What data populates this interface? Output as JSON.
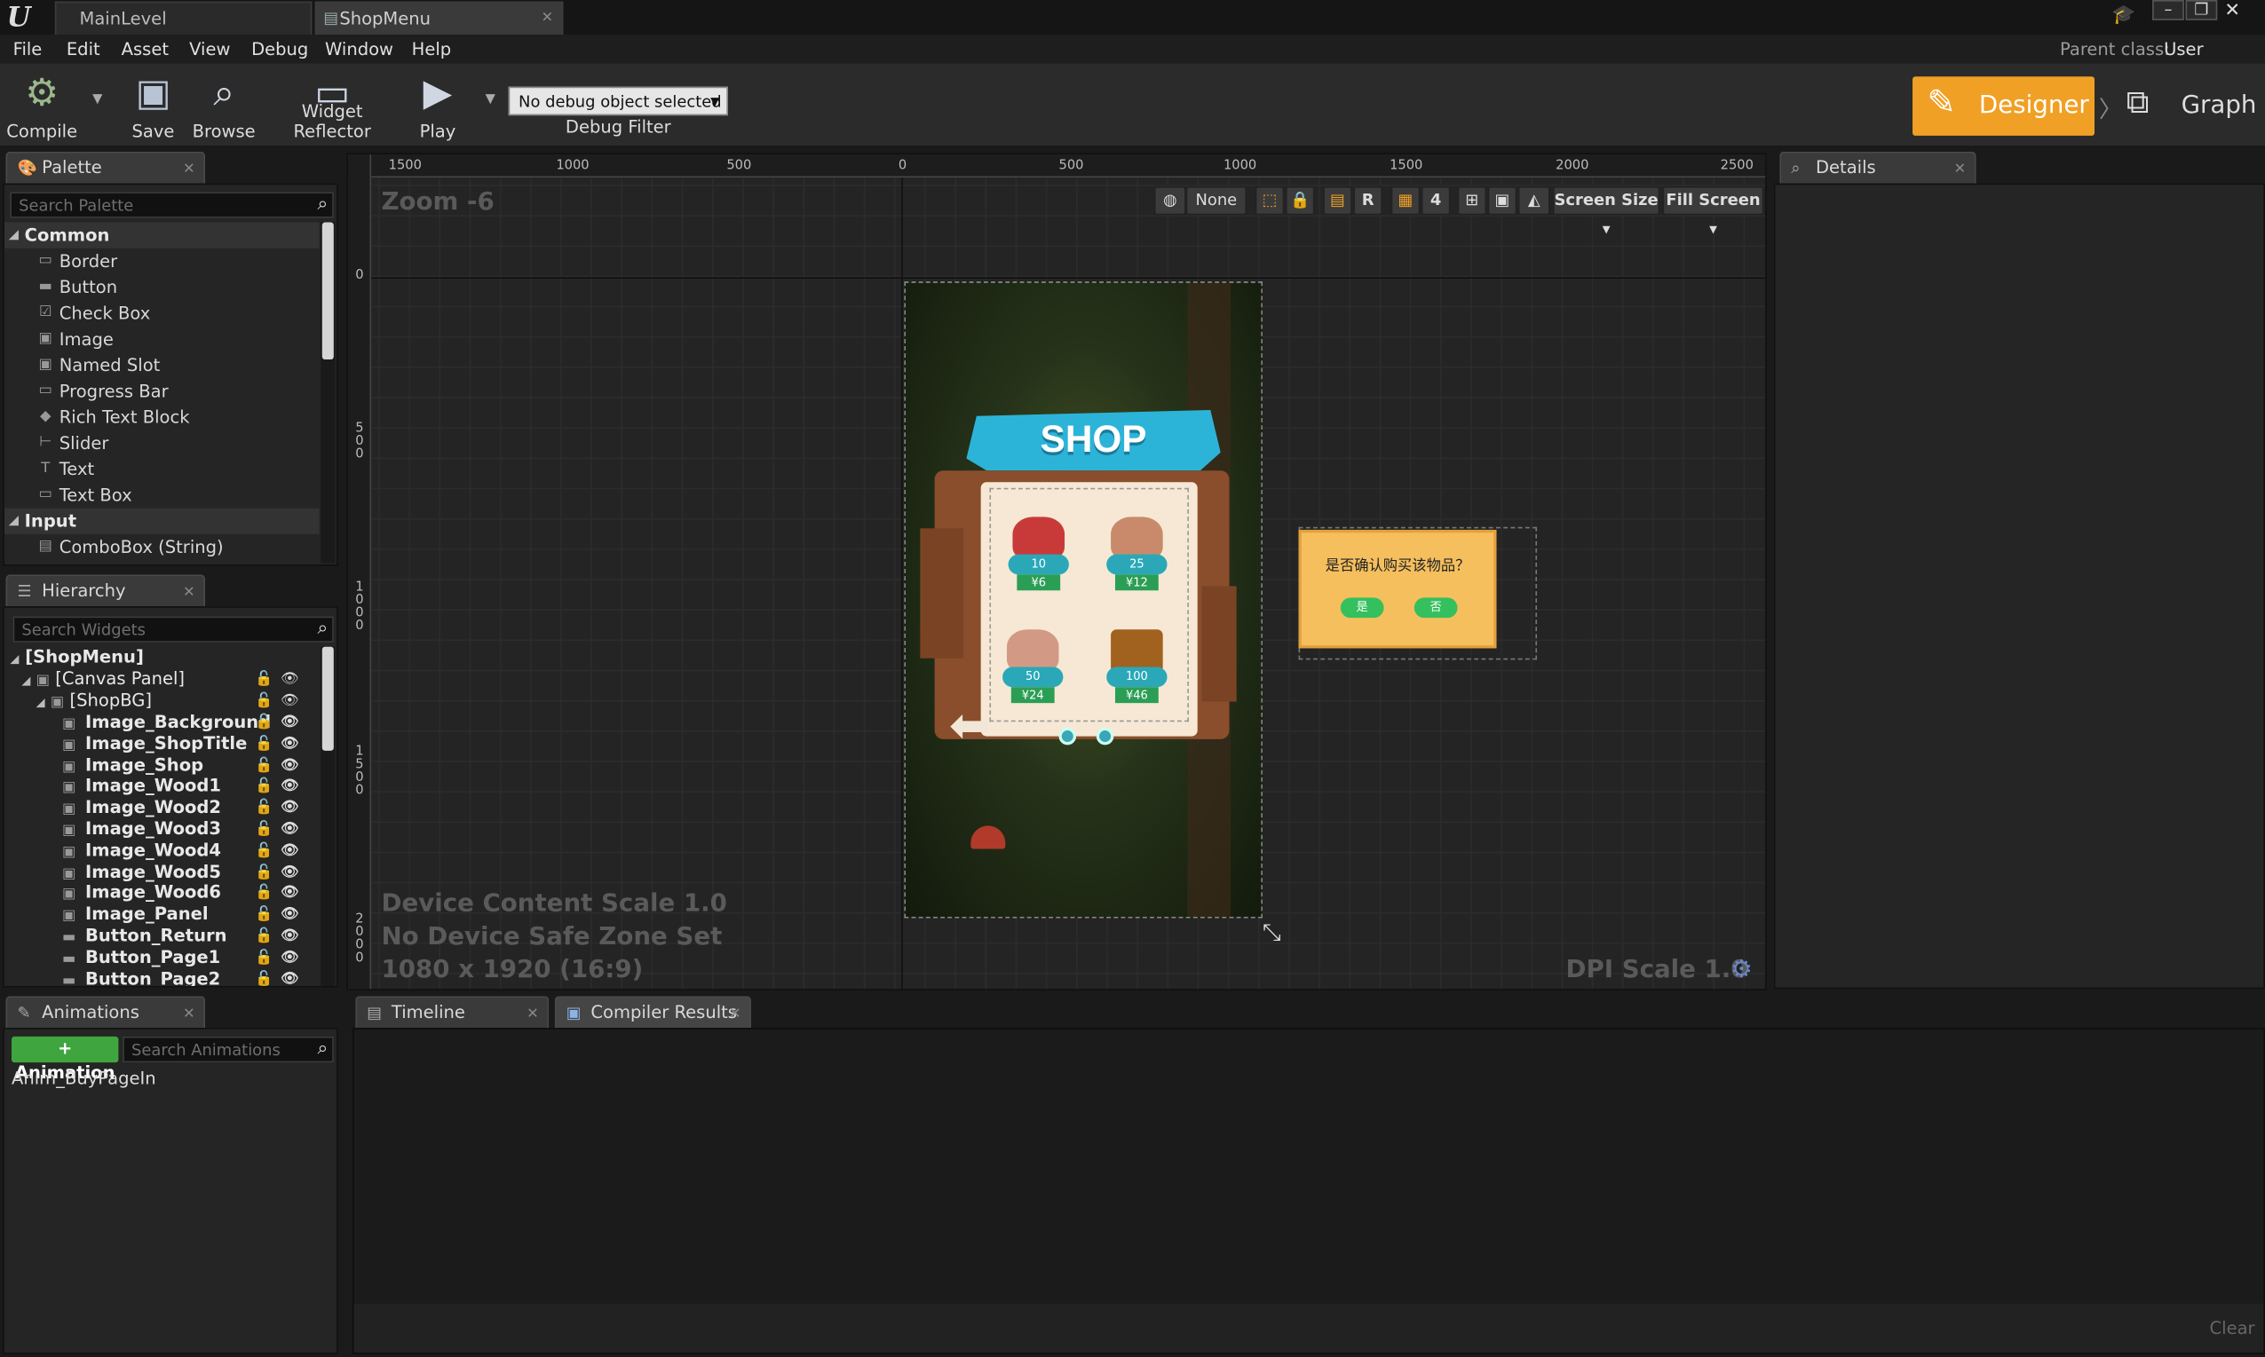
{
  "window": {
    "logo": "U",
    "tabs": [
      {
        "label": "MainLevel"
      },
      {
        "label": "ShopMenu"
      }
    ],
    "minimize": "–",
    "maximize": "❐",
    "close": "✕"
  },
  "menu": [
    "File",
    "Edit",
    "Asset",
    "View",
    "Debug",
    "Window",
    "Help"
  ],
  "parent_class": {
    "label": "Parent class:",
    "value": "User Widget"
  },
  "toolbar": {
    "compile": "Compile",
    "save": "Save",
    "browse": "Browse",
    "widget_reflector": "Widget Reflector",
    "play": "Play",
    "debug_object": "No debug object selected",
    "debug_filter": "Debug Filter"
  },
  "modes": {
    "designer": "Designer",
    "graph": "Graph"
  },
  "palette": {
    "title": "Palette",
    "search_placeholder": "Search Palette",
    "categories": [
      {
        "name": "Common",
        "items": [
          "Border",
          "Button",
          "Check Box",
          "Image",
          "Named Slot",
          "Progress Bar",
          "Rich Text Block",
          "Slider",
          "Text",
          "Text Box"
        ]
      },
      {
        "name": "Input",
        "items": [
          "ComboBox (String)"
        ]
      }
    ]
  },
  "hierarchy": {
    "title": "Hierarchy",
    "search_placeholder": "Search Widgets",
    "root": "[ShopMenu]",
    "canvas": "[Canvas Panel]",
    "shopbg": "[ShopBG]",
    "items": [
      "Image_Background",
      "Image_ShopTitle",
      "Image_Shop",
      "Image_Wood1",
      "Image_Wood2",
      "Image_Wood3",
      "Image_Wood4",
      "Image_Wood5",
      "Image_Wood6",
      "Image_Panel",
      "Button_Return",
      "Button_Page1",
      "Button_Page2"
    ]
  },
  "animations": {
    "title": "Animations",
    "add_label": "+ Animation",
    "search_placeholder": "Search Animations",
    "items": [
      "Anim_BuyPageIn"
    ]
  },
  "viewport": {
    "zoom": "Zoom -6",
    "ruler_h": [
      "1500",
      "1000",
      "500",
      "0",
      "500",
      "1000",
      "1500",
      "2000",
      "2500"
    ],
    "ruler_v": [
      "0",
      "5\n0\n0",
      "1\n0\n0\n0",
      "1\n5\n0\n0",
      "2\n0\n0\n0"
    ],
    "toolbar": {
      "none": "None",
      "r": "R",
      "grid_snap": "4",
      "screen_size": "Screen Size",
      "fill_screen": "Fill Screen"
    },
    "info_lines": [
      "Device Content Scale 1.0",
      "No Device Safe Zone Set",
      "1080 x 1920 (16:9)"
    ],
    "dpi": "DPI Scale 1.0"
  },
  "shop": {
    "title": "SHOP",
    "products": [
      {
        "amount": "10",
        "price": "¥6"
      },
      {
        "amount": "25",
        "price": "¥12"
      },
      {
        "amount": "50",
        "price": "¥24"
      },
      {
        "amount": "100",
        "price": "¥46"
      }
    ]
  },
  "dialog": {
    "text": "是否确认购买该物品？",
    "yes": "是",
    "no": "否"
  },
  "details": {
    "title": "Details"
  },
  "bottom_tabs": {
    "timeline": "Timeline",
    "compiler_results": "Compiler Results"
  },
  "clear": "Clear",
  "colors": {
    "accent": "#f0a024",
    "panel": "#252525",
    "background": "#1a1a1a"
  }
}
